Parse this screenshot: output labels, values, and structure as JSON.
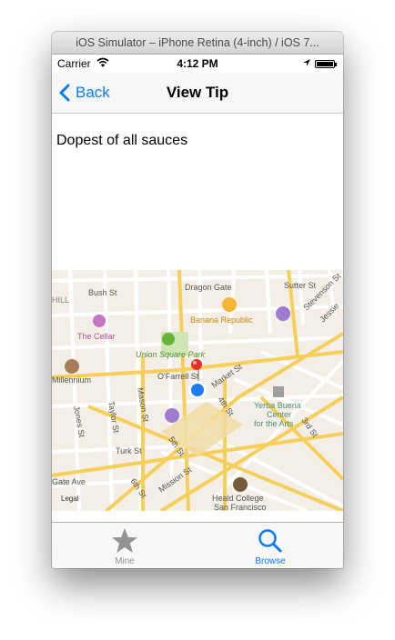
{
  "window": {
    "title": "iOS Simulator – iPhone Retina (4-inch) / iOS 7..."
  },
  "status_bar": {
    "carrier": "Carrier",
    "time": "4:12 PM"
  },
  "nav_bar": {
    "back_label": "Back",
    "title": "View Tip"
  },
  "tip": {
    "text": "Dopest of all sauces"
  },
  "map": {
    "labels": {
      "bush_st": "Bush St",
      "dragon_gate": "Dragon Gate",
      "sutter_st": "Sutter St",
      "stevenson_st": "Stevenson St",
      "jessie": "Jessie",
      "hill": "HILL",
      "the_cellar": "The Cellar",
      "banana_republic": "Banana Republic",
      "union_square_park": "Union Square Park",
      "millennium": "Millennium",
      "ofarrell_st": "O'Farrell St",
      "market_st": "Market St",
      "mason_st": "Mason St",
      "taylor_st": "Taylor St",
      "jones_st": "Jones St",
      "fourth_st": "4th St",
      "yerba_buena": [
        "Yerba Buena",
        "Center",
        "for the Arts"
      ],
      "third_st": "3rd St",
      "turk_st": "Turk St",
      "fifth_st": "5th St",
      "gate_ave": "Gate Ave",
      "legal": "Legal",
      "sixth_st": "6th St",
      "mission_st": "Mission St",
      "heald_college": [
        "Heald College",
        "San Francisco"
      ]
    }
  },
  "tab_bar": {
    "tabs": [
      {
        "label": "Mine",
        "icon": "star-icon",
        "selected": false
      },
      {
        "label": "Browse",
        "icon": "search-icon",
        "selected": true
      }
    ]
  },
  "colors": {
    "accent": "#0a7bf5",
    "inactive_tab": "#929292",
    "major_road": "#f6cf5b"
  }
}
